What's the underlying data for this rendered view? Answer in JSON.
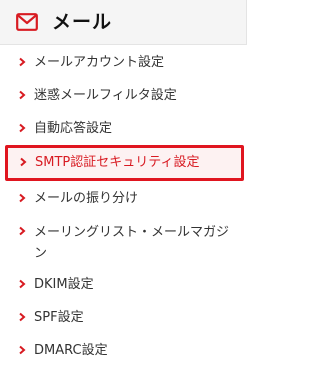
{
  "header": {
    "icon": "mail-envelope-icon",
    "title": "メール"
  },
  "colors": {
    "accent": "#d81b22",
    "selected_border": "#e0151f",
    "selected_bg": "#fdf2f2",
    "header_bg": "#f5f5f5",
    "text": "#333333"
  },
  "nav": {
    "items": [
      {
        "label": "メールアカウント設定"
      },
      {
        "label": "迷惑メールフィルタ設定"
      },
      {
        "label": "自動応答設定"
      },
      {
        "label": "SMTP認証セキュリティ設定",
        "selected": true
      },
      {
        "label": "メールの振り分け"
      },
      {
        "label": "メーリングリスト・メールマガジン"
      },
      {
        "label": "DKIM設定"
      },
      {
        "label": "SPF設定"
      },
      {
        "label": "DMARC設定"
      }
    ]
  }
}
